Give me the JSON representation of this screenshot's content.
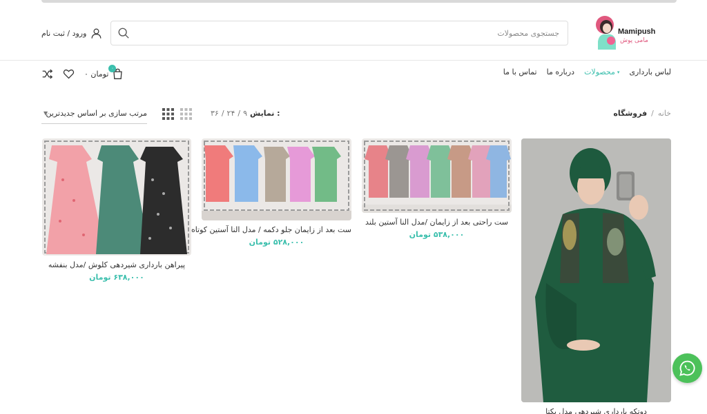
{
  "brand": {
    "name_en": "Mamipush",
    "name_fa": "مامی پوش"
  },
  "search": {
    "placeholder": "جستجوی محصولات"
  },
  "account": {
    "label": "ورود / ثبت نام"
  },
  "menu": [
    {
      "label": "لباس بارداری",
      "active": false
    },
    {
      "label": "محصولات",
      "active": true
    },
    {
      "label": "درباره ما",
      "active": false
    },
    {
      "label": "تماس با ما",
      "active": false
    }
  ],
  "cart": {
    "count": "۰",
    "total": "۰ تومان"
  },
  "breadcrumb": {
    "home": "خانه",
    "separator": "/",
    "current": "فروشگاه"
  },
  "per_page": {
    "label": "نمایش :",
    "options": [
      "۹",
      "۲۴",
      "۳۶"
    ],
    "separator": "/"
  },
  "sort": {
    "label": "مرتب سازی بر اساس جدیدترین"
  },
  "products": [
    {
      "title": "دوتکه بارداری شیردهی مدل یکتا",
      "price": ""
    },
    {
      "title": "ست راحتی بعد از زایمان /مدل النا آستین بلند",
      "price": "۵۳۸,۰۰۰ تومان"
    },
    {
      "title": "ست بعد از زایمان جلو دکمه / مدل النا آستین کوتاه",
      "price": "۵۲۸,۰۰۰ تومان"
    },
    {
      "title": "پیراهن بارداری شیردهی کلوش /مدل بنفشه",
      "price": "۶۳۸,۰۰۰ تومان"
    }
  ],
  "colors": {
    "accent": "#3bbfad",
    "whatsapp": "#4cc15a",
    "brand_pink": "#e0587e",
    "dress_green": "#1f5c3f"
  },
  "icons": [
    "user-icon",
    "search-icon",
    "cart-icon",
    "heart-icon",
    "shuffle-icon",
    "grid-2-icon",
    "grid-3-icon",
    "chevron-down-icon",
    "whatsapp-icon"
  ]
}
